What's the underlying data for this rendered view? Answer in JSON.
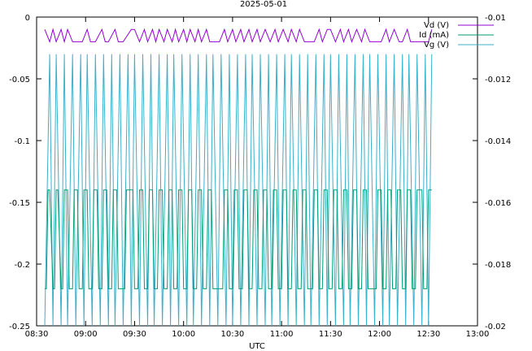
{
  "chart_data": {
    "type": "line",
    "title": "2025-05-01",
    "xlabel": "UTC",
    "ylabel": "",
    "xlim": [
      "08:30",
      "13:00"
    ],
    "ylim": [
      -0.25,
      0
    ],
    "y2lim": [
      -0.02,
      -0.01
    ],
    "grid": false,
    "legend_position": "top-right",
    "x_ticks": [
      "08:30",
      "09:00",
      "09:30",
      "10:00",
      "10:30",
      "11:00",
      "11:30",
      "12:00",
      "12:30",
      "13:00"
    ],
    "y_ticks": [
      "0",
      "-0.05",
      "-0.1",
      "-0.15",
      "-0.2",
      "-0.25"
    ],
    "y2_ticks": [
      "-0.01",
      "-0.012",
      "-0.014",
      "-0.016",
      "-0.018",
      "-0.02"
    ],
    "series": [
      {
        "name": "Vd (V)",
        "axis": "y",
        "color": "#9400d3",
        "x": [
          "08:35",
          "08:38",
          "08:40",
          "08:42",
          "08:45",
          "08:47",
          "08:49",
          "08:52",
          "08:58",
          "09:01",
          "09:03",
          "09:06",
          "09:10",
          "09:12",
          "09:14",
          "09:18",
          "09:20",
          "09:23",
          "09:28",
          "09:30",
          "09:33",
          "09:36",
          "09:38",
          "09:41",
          "09:43",
          "09:45",
          "09:48",
          "09:50",
          "09:53",
          "09:55",
          "09:57",
          "10:00",
          "10:02",
          "10:04",
          "10:07",
          "10:09",
          "10:11",
          "10:14",
          "10:16",
          "10:22",
          "10:25",
          "10:27",
          "10:30",
          "10:32",
          "10:35",
          "10:37",
          "10:40",
          "10:42",
          "10:45",
          "10:47",
          "10:50",
          "10:53",
          "10:56",
          "10:58",
          "11:01",
          "11:04",
          "11:06",
          "11:09",
          "11:11",
          "11:14",
          "11:20",
          "11:23",
          "11:25",
          "11:28",
          "11:30",
          "11:33",
          "11:36",
          "11:38",
          "11:41",
          "11:43",
          "11:46",
          "11:49",
          "11:51",
          "11:54",
          "11:58",
          "12:01",
          "12:04",
          "12:06",
          "12:09",
          "12:12",
          "12:14",
          "12:17",
          "12:19",
          "12:23",
          "12:26",
          "12:28",
          "12:30",
          "12:32"
        ],
        "values": [
          -0.01,
          -0.02,
          -0.01,
          -0.02,
          -0.01,
          -0.02,
          -0.01,
          -0.02,
          -0.02,
          -0.01,
          -0.02,
          -0.02,
          -0.01,
          -0.02,
          -0.02,
          -0.01,
          -0.02,
          -0.02,
          -0.01,
          -0.01,
          -0.02,
          -0.01,
          -0.02,
          -0.01,
          -0.02,
          -0.01,
          -0.02,
          -0.01,
          -0.02,
          -0.01,
          -0.02,
          -0.01,
          -0.02,
          -0.01,
          -0.02,
          -0.01,
          -0.02,
          -0.01,
          -0.02,
          -0.02,
          -0.01,
          -0.02,
          -0.01,
          -0.02,
          -0.01,
          -0.02,
          -0.01,
          -0.02,
          -0.01,
          -0.02,
          -0.01,
          -0.02,
          -0.01,
          -0.02,
          -0.01,
          -0.02,
          -0.01,
          -0.02,
          -0.01,
          -0.02,
          -0.02,
          -0.01,
          -0.02,
          -0.01,
          -0.01,
          -0.02,
          -0.01,
          -0.02,
          -0.01,
          -0.02,
          -0.01,
          -0.02,
          -0.01,
          -0.02,
          -0.02,
          -0.02,
          -0.01,
          -0.02,
          -0.01,
          -0.02,
          -0.02,
          -0.01,
          -0.02,
          -0.02,
          -0.02,
          -0.02,
          -0.02,
          -0.01
        ]
      },
      {
        "name": "Id (mA)",
        "axis": "y",
        "color": "#009e73",
        "x": [
          "08:35",
          "08:36",
          "08:37",
          "08:38",
          "08:40",
          "08:41",
          "08:42",
          "08:43",
          "08:45",
          "08:46",
          "08:47",
          "08:49",
          "08:50",
          "08:52",
          "08:53",
          "08:55",
          "08:56",
          "08:58",
          "08:59",
          "09:01",
          "09:02",
          "09:04",
          "09:05",
          "09:07",
          "09:08",
          "09:10",
          "09:11",
          "09:13",
          "09:14",
          "09:16",
          "09:17",
          "09:19",
          "09:20",
          "09:24",
          "09:25",
          "09:29",
          "09:30",
          "09:32",
          "09:33",
          "09:35",
          "09:36",
          "09:38",
          "09:39",
          "09:41",
          "09:42",
          "09:44",
          "09:45",
          "09:47",
          "09:48",
          "09:50",
          "09:51",
          "09:53",
          "09:54",
          "09:56",
          "09:57",
          "09:59",
          "10:00",
          "10:02",
          "10:03",
          "10:05",
          "10:06",
          "10:08",
          "10:09",
          "10:11",
          "10:12",
          "10:14",
          "10:15",
          "10:17",
          "10:18",
          "10:24",
          "10:25",
          "10:27",
          "10:28",
          "10:30",
          "10:31",
          "10:33",
          "10:34",
          "10:36",
          "10:37",
          "10:39",
          "10:40",
          "10:42",
          "10:43",
          "10:45",
          "10:46",
          "10:48",
          "10:49",
          "10:51",
          "10:52",
          "10:54",
          "10:55",
          "10:57",
          "10:58",
          "11:00",
          "11:01",
          "11:03",
          "11:04",
          "11:06",
          "11:07",
          "11:09",
          "11:10",
          "11:12",
          "11:13",
          "11:15",
          "11:16",
          "11:19",
          "11:20",
          "11:22",
          "11:23",
          "11:25",
          "11:26",
          "11:28",
          "11:29",
          "11:31",
          "11:32",
          "11:34",
          "11:35",
          "11:37",
          "11:38",
          "11:40",
          "11:41",
          "11:43",
          "11:44",
          "11:46",
          "11:47",
          "11:49",
          "11:50",
          "11:52",
          "11:53",
          "11:58",
          "11:59",
          "12:01",
          "12:02",
          "12:04",
          "12:05",
          "12:07",
          "12:08",
          "12:10",
          "12:11",
          "12:13",
          "12:14",
          "12:16",
          "12:17",
          "12:19",
          "12:20",
          "12:22",
          "12:23",
          "12:26",
          "12:27",
          "12:29",
          "12:30",
          "12:32"
        ],
        "values": [
          -0.22,
          -0.22,
          -0.14,
          -0.14,
          -0.22,
          -0.22,
          -0.14,
          -0.14,
          -0.22,
          -0.22,
          -0.14,
          -0.14,
          -0.22,
          -0.22,
          -0.14,
          -0.14,
          -0.22,
          -0.22,
          -0.14,
          -0.14,
          -0.22,
          -0.22,
          -0.14,
          -0.14,
          -0.22,
          -0.22,
          -0.14,
          -0.14,
          -0.22,
          -0.22,
          -0.14,
          -0.14,
          -0.22,
          -0.22,
          -0.14,
          -0.14,
          -0.22,
          -0.22,
          -0.14,
          -0.14,
          -0.22,
          -0.22,
          -0.14,
          -0.14,
          -0.22,
          -0.22,
          -0.14,
          -0.14,
          -0.22,
          -0.22,
          -0.14,
          -0.14,
          -0.22,
          -0.22,
          -0.14,
          -0.14,
          -0.22,
          -0.22,
          -0.14,
          -0.14,
          -0.22,
          -0.22,
          -0.14,
          -0.14,
          -0.22,
          -0.22,
          -0.14,
          -0.14,
          -0.22,
          -0.22,
          -0.14,
          -0.14,
          -0.22,
          -0.22,
          -0.14,
          -0.14,
          -0.22,
          -0.22,
          -0.14,
          -0.14,
          -0.22,
          -0.22,
          -0.14,
          -0.14,
          -0.22,
          -0.22,
          -0.14,
          -0.14,
          -0.22,
          -0.22,
          -0.14,
          -0.14,
          -0.22,
          -0.22,
          -0.14,
          -0.14,
          -0.22,
          -0.22,
          -0.14,
          -0.14,
          -0.22,
          -0.22,
          -0.14,
          -0.14,
          -0.22,
          -0.22,
          -0.14,
          -0.14,
          -0.22,
          -0.22,
          -0.14,
          -0.14,
          -0.22,
          -0.22,
          -0.14,
          -0.14,
          -0.22,
          -0.22,
          -0.14,
          -0.14,
          -0.22,
          -0.22,
          -0.14,
          -0.14,
          -0.22,
          -0.22,
          -0.14,
          -0.14,
          -0.22,
          -0.22,
          -0.14,
          -0.14,
          -0.22,
          -0.22,
          -0.14,
          -0.14,
          -0.22,
          -0.22,
          -0.14,
          -0.14,
          -0.22,
          -0.22,
          -0.14,
          -0.14,
          -0.22,
          -0.22,
          -0.14,
          -0.14,
          -0.22,
          -0.22,
          -0.14,
          -0.14
        ]
      },
      {
        "name": "Vg (V)",
        "axis": "y2",
        "color": "#3bb0c9",
        "x": [
          "08:35",
          "08:38",
          "08:40",
          "08:42",
          "08:45",
          "08:47",
          "08:49",
          "08:52",
          "08:54",
          "08:57",
          "08:59",
          "09:01",
          "09:04",
          "09:06",
          "09:09",
          "09:11",
          "09:14",
          "09:16",
          "09:18",
          "09:21",
          "09:23",
          "09:26",
          "09:28",
          "09:30",
          "09:33",
          "09:35",
          "09:38",
          "09:40",
          "09:42",
          "09:45",
          "09:47",
          "09:50",
          "09:52",
          "09:54",
          "09:57",
          "09:59",
          "10:02",
          "10:04",
          "10:06",
          "10:09",
          "10:11",
          "10:14",
          "10:16",
          "10:18",
          "10:21",
          "10:23",
          "10:26",
          "10:28",
          "10:30",
          "10:33",
          "10:35",
          "10:38",
          "10:40",
          "10:42",
          "10:45",
          "10:47",
          "10:50",
          "10:52",
          "10:54",
          "10:57",
          "10:59",
          "11:02",
          "11:04",
          "11:06",
          "11:09",
          "11:11",
          "11:14",
          "11:16",
          "11:18",
          "11:21",
          "11:23",
          "11:26",
          "11:28",
          "11:30",
          "11:33",
          "11:35",
          "11:38",
          "11:40",
          "11:42",
          "11:45",
          "11:47",
          "11:50",
          "11:52",
          "11:54",
          "11:57",
          "11:59",
          "12:02",
          "12:04",
          "12:06",
          "12:09",
          "12:11",
          "12:14",
          "12:16",
          "12:18",
          "12:21",
          "12:23",
          "12:26",
          "12:28",
          "12:30",
          "12:32"
        ],
        "values": [
          -0.02,
          -0.0112,
          -0.02,
          -0.0112,
          -0.02,
          -0.0112,
          -0.02,
          -0.0112,
          -0.02,
          -0.0112,
          -0.02,
          -0.0112,
          -0.02,
          -0.0112,
          -0.02,
          -0.0112,
          -0.02,
          -0.0112,
          -0.02,
          -0.0112,
          -0.02,
          -0.0112,
          -0.02,
          -0.0112,
          -0.02,
          -0.0112,
          -0.02,
          -0.0112,
          -0.02,
          -0.0112,
          -0.02,
          -0.0112,
          -0.02,
          -0.0112,
          -0.02,
          -0.0112,
          -0.02,
          -0.0112,
          -0.02,
          -0.0112,
          -0.02,
          -0.0112,
          -0.02,
          -0.0112,
          -0.02,
          -0.0112,
          -0.02,
          -0.0112,
          -0.02,
          -0.0112,
          -0.02,
          -0.0112,
          -0.02,
          -0.0112,
          -0.02,
          -0.0112,
          -0.02,
          -0.0112,
          -0.02,
          -0.0112,
          -0.02,
          -0.0112,
          -0.02,
          -0.0112,
          -0.02,
          -0.0112,
          -0.02,
          -0.0112,
          -0.02,
          -0.0112,
          -0.02,
          -0.0112,
          -0.02,
          -0.0112,
          -0.02,
          -0.0112,
          -0.02,
          -0.0112,
          -0.02,
          -0.0112,
          -0.02,
          -0.0112,
          -0.02,
          -0.0112,
          -0.02,
          -0.0112,
          -0.02,
          -0.0112,
          -0.02,
          -0.0112,
          -0.02,
          -0.0112,
          -0.02,
          -0.0112,
          -0.02,
          -0.0112,
          -0.02,
          -0.0112,
          -0.02,
          -0.0112
        ]
      }
    ]
  }
}
